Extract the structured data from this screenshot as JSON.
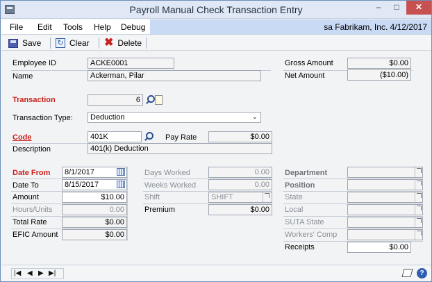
{
  "window": {
    "title": "Payroll Manual Check Transaction Entry",
    "minimize": "–",
    "maximize": "□",
    "close": "✕"
  },
  "menu": {
    "items": [
      "File",
      "Edit",
      "Tools",
      "Help",
      "Debug"
    ],
    "user_info": "sa  Fabrikam, Inc.  4/12/2017"
  },
  "toolbar": {
    "save_label": "Save",
    "clear_label": "Clear",
    "delete_label": "Delete"
  },
  "employee": {
    "id_label": "Employee ID",
    "id_value": "ACKE0001",
    "name_label": "Name",
    "name_value": "Ackerman, Pilar"
  },
  "totals": {
    "gross_label": "Gross Amount",
    "gross_value": "$0.00",
    "net_label": "Net Amount",
    "net_value": "($10.00)"
  },
  "transaction": {
    "label": "Transaction",
    "value": "6",
    "type_label": "Transaction Type:",
    "type_value": "Deduction",
    "code_label": "Code",
    "code_value": "401K",
    "pay_rate_label": "Pay Rate",
    "pay_rate_value": "$0.00",
    "description_label": "Description",
    "description_value": "401(k) Deduction"
  },
  "dates": {
    "from_label": "Date From",
    "from_value": "8/1/2017",
    "to_label": "Date To",
    "to_value": "8/15/2017"
  },
  "amounts": {
    "amount_label": "Amount",
    "amount_value": "$10.00",
    "hours_label": "Hours/Units",
    "hours_value": "0.00",
    "total_rate_label": "Total Rate",
    "total_rate_value": "$0.00",
    "efic_label": "EFIC Amount",
    "efic_value": "$0.00"
  },
  "work": {
    "days_label": "Days Worked",
    "days_value": "0.00",
    "weeks_label": "Weeks Worked",
    "weeks_value": "0.00",
    "shift_label": "Shift",
    "shift_value": "SHIFT",
    "premium_label": "Premium",
    "premium_value": "$0.00"
  },
  "location": {
    "department_label": "Department",
    "position_label": "Position",
    "state_label": "State",
    "local_label": "Local",
    "suta_label": "SUTA State",
    "workers_comp_label": "Workers' Comp",
    "receipts_label": "Receipts",
    "receipts_value": "$0.00"
  },
  "statusbar": {
    "nav": [
      "|◀",
      "◀",
      "▶",
      "▶|"
    ],
    "help": "?"
  },
  "colors": {
    "required_label": "#c8201c",
    "titlebar": "#dfe8f4",
    "userinfo_bg": "#c9daf5"
  }
}
